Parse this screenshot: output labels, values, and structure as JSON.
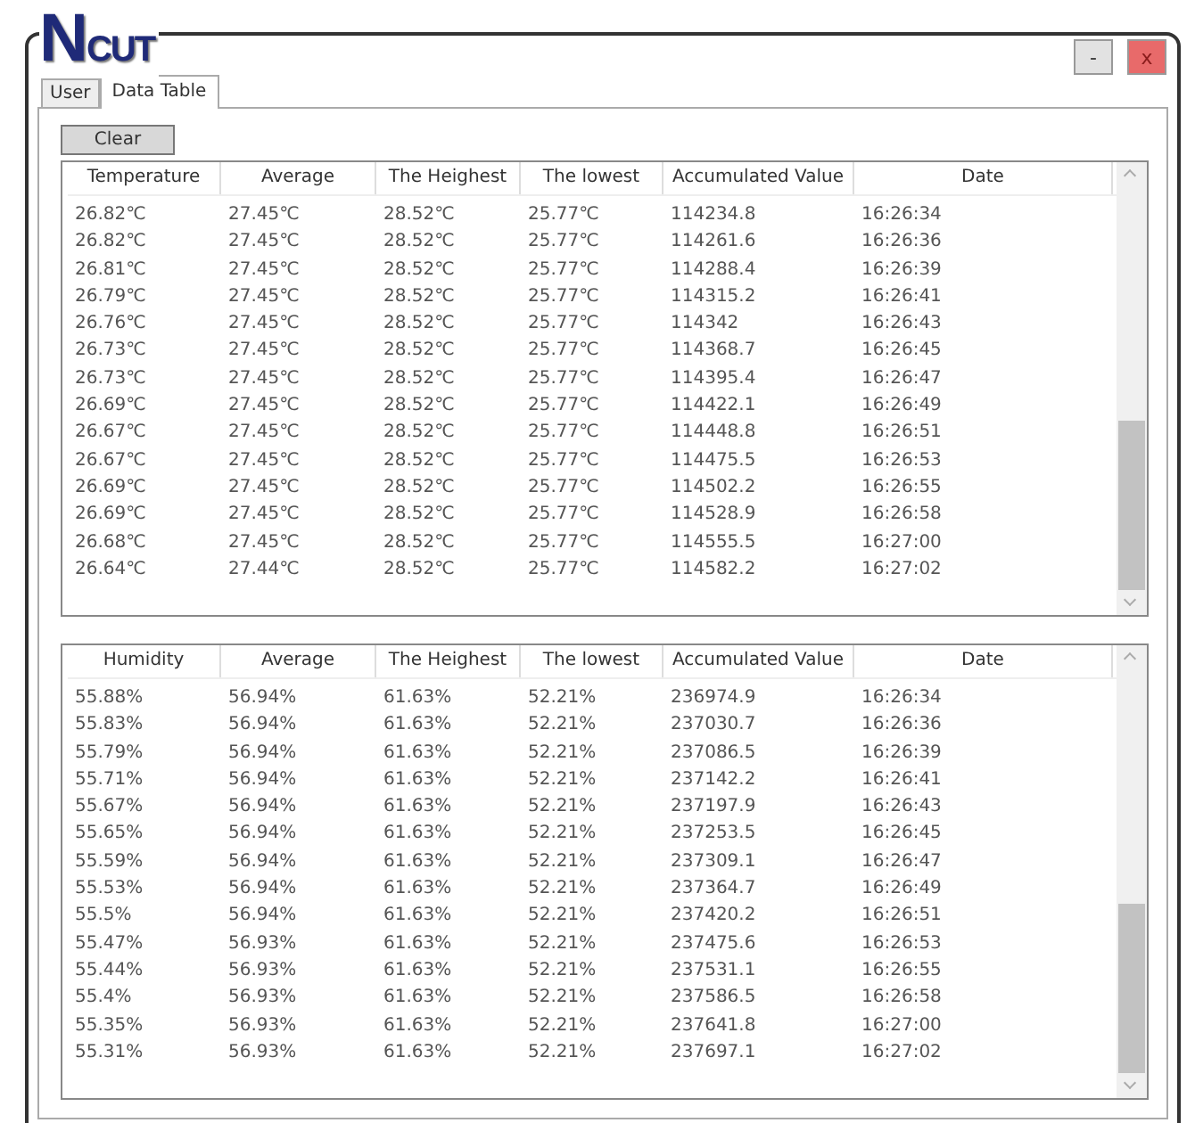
{
  "logo": "NCUT",
  "window_buttons": [
    {
      "kind": "minimize",
      "label": "-"
    },
    {
      "kind": "close",
      "label": "x"
    }
  ],
  "tabs": [
    {
      "label": "User",
      "selected": false
    },
    {
      "label": "Data Table",
      "selected": true
    }
  ],
  "clear_button": "Clear",
  "tables": [
    {
      "columns": [
        "Temperature",
        "Average",
        "The Heighest",
        "The lowest",
        "Accumulated Value",
        "Date"
      ],
      "rows": [
        [
          "26.82℃",
          "27.45℃",
          "28.52℃",
          "25.77℃",
          "114234.8",
          "16:26:34"
        ],
        [
          "26.82℃",
          "27.45℃",
          "28.52℃",
          "25.77℃",
          "114261.6",
          "16:26:36"
        ],
        [
          "26.81℃",
          "27.45℃",
          "28.52℃",
          "25.77℃",
          "114288.4",
          "16:26:39"
        ],
        [
          "26.79℃",
          "27.45℃",
          "28.52℃",
          "25.77℃",
          "114315.2",
          "16:26:41"
        ],
        [
          "26.76℃",
          "27.45℃",
          "28.52℃",
          "25.77℃",
          "114342",
          "16:26:43"
        ],
        [
          "26.73℃",
          "27.45℃",
          "28.52℃",
          "25.77℃",
          "114368.7",
          "16:26:45"
        ],
        [
          "26.73℃",
          "27.45℃",
          "28.52℃",
          "25.77℃",
          "114395.4",
          "16:26:47"
        ],
        [
          "26.69℃",
          "27.45℃",
          "28.52℃",
          "25.77℃",
          "114422.1",
          "16:26:49"
        ],
        [
          "26.67℃",
          "27.45℃",
          "28.52℃",
          "25.77℃",
          "114448.8",
          "16:26:51"
        ],
        [
          "26.67℃",
          "27.45℃",
          "28.52℃",
          "25.77℃",
          "114475.5",
          "16:26:53"
        ],
        [
          "26.69℃",
          "27.45℃",
          "28.52℃",
          "25.77℃",
          "114502.2",
          "16:26:55"
        ],
        [
          "26.69℃",
          "27.45℃",
          "28.52℃",
          "25.77℃",
          "114528.9",
          "16:26:58"
        ],
        [
          "26.68℃",
          "27.45℃",
          "28.52℃",
          "25.77℃",
          "114555.5",
          "16:27:00"
        ],
        [
          "26.64℃",
          "27.44℃",
          "28.52℃",
          "25.77℃",
          "114582.2",
          "16:27:02"
        ]
      ]
    },
    {
      "columns": [
        "Humidity",
        "Average",
        "The Heighest",
        "The lowest",
        "Accumulated Value",
        "Date"
      ],
      "rows": [
        [
          "55.88%",
          "56.94%",
          "61.63%",
          "52.21%",
          "236974.9",
          "16:26:34"
        ],
        [
          "55.83%",
          "56.94%",
          "61.63%",
          "52.21%",
          "237030.7",
          "16:26:36"
        ],
        [
          "55.79%",
          "56.94%",
          "61.63%",
          "52.21%",
          "237086.5",
          "16:26:39"
        ],
        [
          "55.71%",
          "56.94%",
          "61.63%",
          "52.21%",
          "237142.2",
          "16:26:41"
        ],
        [
          "55.67%",
          "56.94%",
          "61.63%",
          "52.21%",
          "237197.9",
          "16:26:43"
        ],
        [
          "55.65%",
          "56.94%",
          "61.63%",
          "52.21%",
          "237253.5",
          "16:26:45"
        ],
        [
          "55.59%",
          "56.94%",
          "61.63%",
          "52.21%",
          "237309.1",
          "16:26:47"
        ],
        [
          "55.53%",
          "56.94%",
          "61.63%",
          "52.21%",
          "237364.7",
          "16:26:49"
        ],
        [
          "55.5%",
          "56.94%",
          "61.63%",
          "52.21%",
          "237420.2",
          "16:26:51"
        ],
        [
          "55.47%",
          "56.93%",
          "61.63%",
          "52.21%",
          "237475.6",
          "16:26:53"
        ],
        [
          "55.44%",
          "56.93%",
          "61.63%",
          "52.21%",
          "237531.1",
          "16:26:55"
        ],
        [
          "55.4%",
          "56.93%",
          "61.63%",
          "52.21%",
          "237586.5",
          "16:26:58"
        ],
        [
          "55.35%",
          "56.93%",
          "61.63%",
          "52.21%",
          "237641.8",
          "16:27:00"
        ],
        [
          "55.31%",
          "56.93%",
          "61.63%",
          "52.21%",
          "237697.1",
          "16:27:02"
        ]
      ]
    }
  ]
}
